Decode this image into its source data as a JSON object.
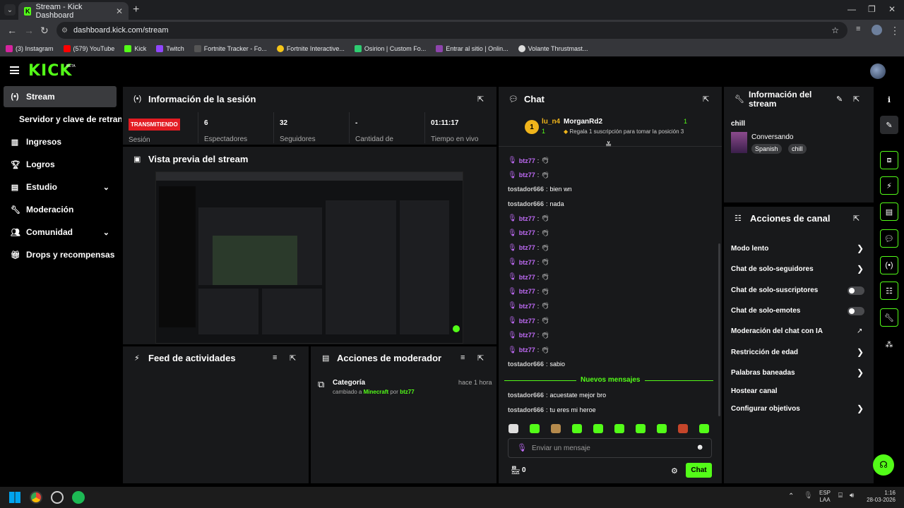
{
  "browser": {
    "tab_title": "Stream - Kick Dashboard",
    "tab_favicon": "K",
    "url": "dashboard.kick.com/stream",
    "bookmarks": [
      "(3) Instagram",
      "(579) YouTube",
      "Kick",
      "Twitch",
      "Fortnite Tracker - Fo...",
      "Fortnite Interactive...",
      "Osirion | Custom Fo...",
      "Entrar al sitio | Onlin...",
      "Volante Thrustmast..."
    ]
  },
  "header": {
    "logo": "KICK",
    "beta": "BETA"
  },
  "sidebar": {
    "items": [
      {
        "label": "Stream",
        "icon": "broadcast-icon"
      },
      {
        "label": "Servidor y clave de retransmisión",
        "icon": ""
      },
      {
        "label": "Ingresos",
        "icon": "chart-icon"
      },
      {
        "label": "Logros",
        "icon": "trophy-icon"
      },
      {
        "label": "Estudio",
        "icon": "layout-icon"
      },
      {
        "label": "Moderación",
        "icon": "wrench-icon"
      },
      {
        "label": "Comunidad",
        "icon": "people-icon"
      },
      {
        "label": "Drops y recompensas",
        "icon": "gift-icon"
      }
    ]
  },
  "session": {
    "title": "Información de la sesión",
    "live_badge": "TRANSMITIENDO",
    "session_label": "Sesión",
    "stats": [
      {
        "value": "6",
        "label": "Espectadores"
      },
      {
        "value": "32",
        "label": "Seguidores"
      },
      {
        "value": "-",
        "label": "Cantidad de"
      },
      {
        "value": "01:11:17",
        "label": "Tiempo en vivo"
      }
    ]
  },
  "preview": {
    "title": "Vista previa del stream"
  },
  "feed": {
    "title": "Feed de actividades"
  },
  "modactions": {
    "title": "Acciones de moderador",
    "item_title": "Categoría",
    "item_time": "hace 1 hora",
    "item_text_a": "cambiado a",
    "item_game": "Minecraft",
    "item_text_b": "por",
    "item_user": "btz77"
  },
  "chat": {
    "title": "Chat",
    "top1_name": "lu_n4",
    "top1_count": "1",
    "top2_name": "MorganRd2",
    "top2_count": "1",
    "top_sub_text": "Regala 1 suscripción para tomar la posición 3",
    "rank": "1",
    "messages": [
      {
        "user": "btz77",
        "text": "",
        "mic": true
      },
      {
        "user": "btz77",
        "text": "",
        "mic": true
      },
      {
        "user": "tostador666",
        "text": "bien wn",
        "mic": false
      },
      {
        "user": "tostador666",
        "text": "nada",
        "mic": false
      },
      {
        "user": "btz77",
        "text": "",
        "mic": true
      },
      {
        "user": "btz77",
        "text": "",
        "mic": true
      },
      {
        "user": "btz77",
        "text": "",
        "mic": true
      },
      {
        "user": "btz77",
        "text": "",
        "mic": true
      },
      {
        "user": "btz77",
        "text": "",
        "mic": true
      },
      {
        "user": "btz77",
        "text": "",
        "mic": true
      },
      {
        "user": "btz77",
        "text": "",
        "mic": true
      },
      {
        "user": "btz77",
        "text": "",
        "mic": true
      },
      {
        "user": "btz77",
        "text": "",
        "mic": true
      },
      {
        "user": "btz77",
        "text": "",
        "mic": true
      },
      {
        "user": "tostador666",
        "text": "sabio",
        "mic": false
      }
    ],
    "new_messages": "Nuevos mensajes",
    "after": [
      {
        "user": "tostador666",
        "text": "acuestate mejor bro"
      },
      {
        "user": "tostador666",
        "text": "tu eres mi heroe"
      }
    ],
    "input_placeholder": "Enviar un mensaje",
    "points": "0",
    "send": "Chat"
  },
  "streaminfo": {
    "title": "Información del stream",
    "stream_title": "chill",
    "category": "Conversando",
    "tags": [
      "Spanish",
      "chill"
    ]
  },
  "channel": {
    "title": "Acciones de canal",
    "items": [
      {
        "label": "Modo lento",
        "control": "chevron"
      },
      {
        "label": "Chat de solo-seguidores",
        "control": "chevron"
      },
      {
        "label": "Chat de solo-suscriptores",
        "control": "toggle",
        "on": false
      },
      {
        "label": "Chat de solo-emotes",
        "control": "toggle",
        "on": false
      },
      {
        "label": "Moderación del chat con IA",
        "control": "external"
      },
      {
        "label": "Restricción de edad",
        "control": "chevron"
      },
      {
        "label": "Palabras baneadas",
        "control": "chevron"
      },
      {
        "label": "Hostear canal",
        "control": "none"
      },
      {
        "label": "Configurar objetivos",
        "control": "chevron"
      }
    ]
  },
  "taskbar": {
    "lang": "ESP",
    "layout": "LAA",
    "time": "1:16",
    "date": "28-03-2026"
  },
  "colors": {
    "accent": "#53fc18",
    "live": "#e31c23",
    "username": "#c06bf7",
    "panel": "#18191b"
  }
}
